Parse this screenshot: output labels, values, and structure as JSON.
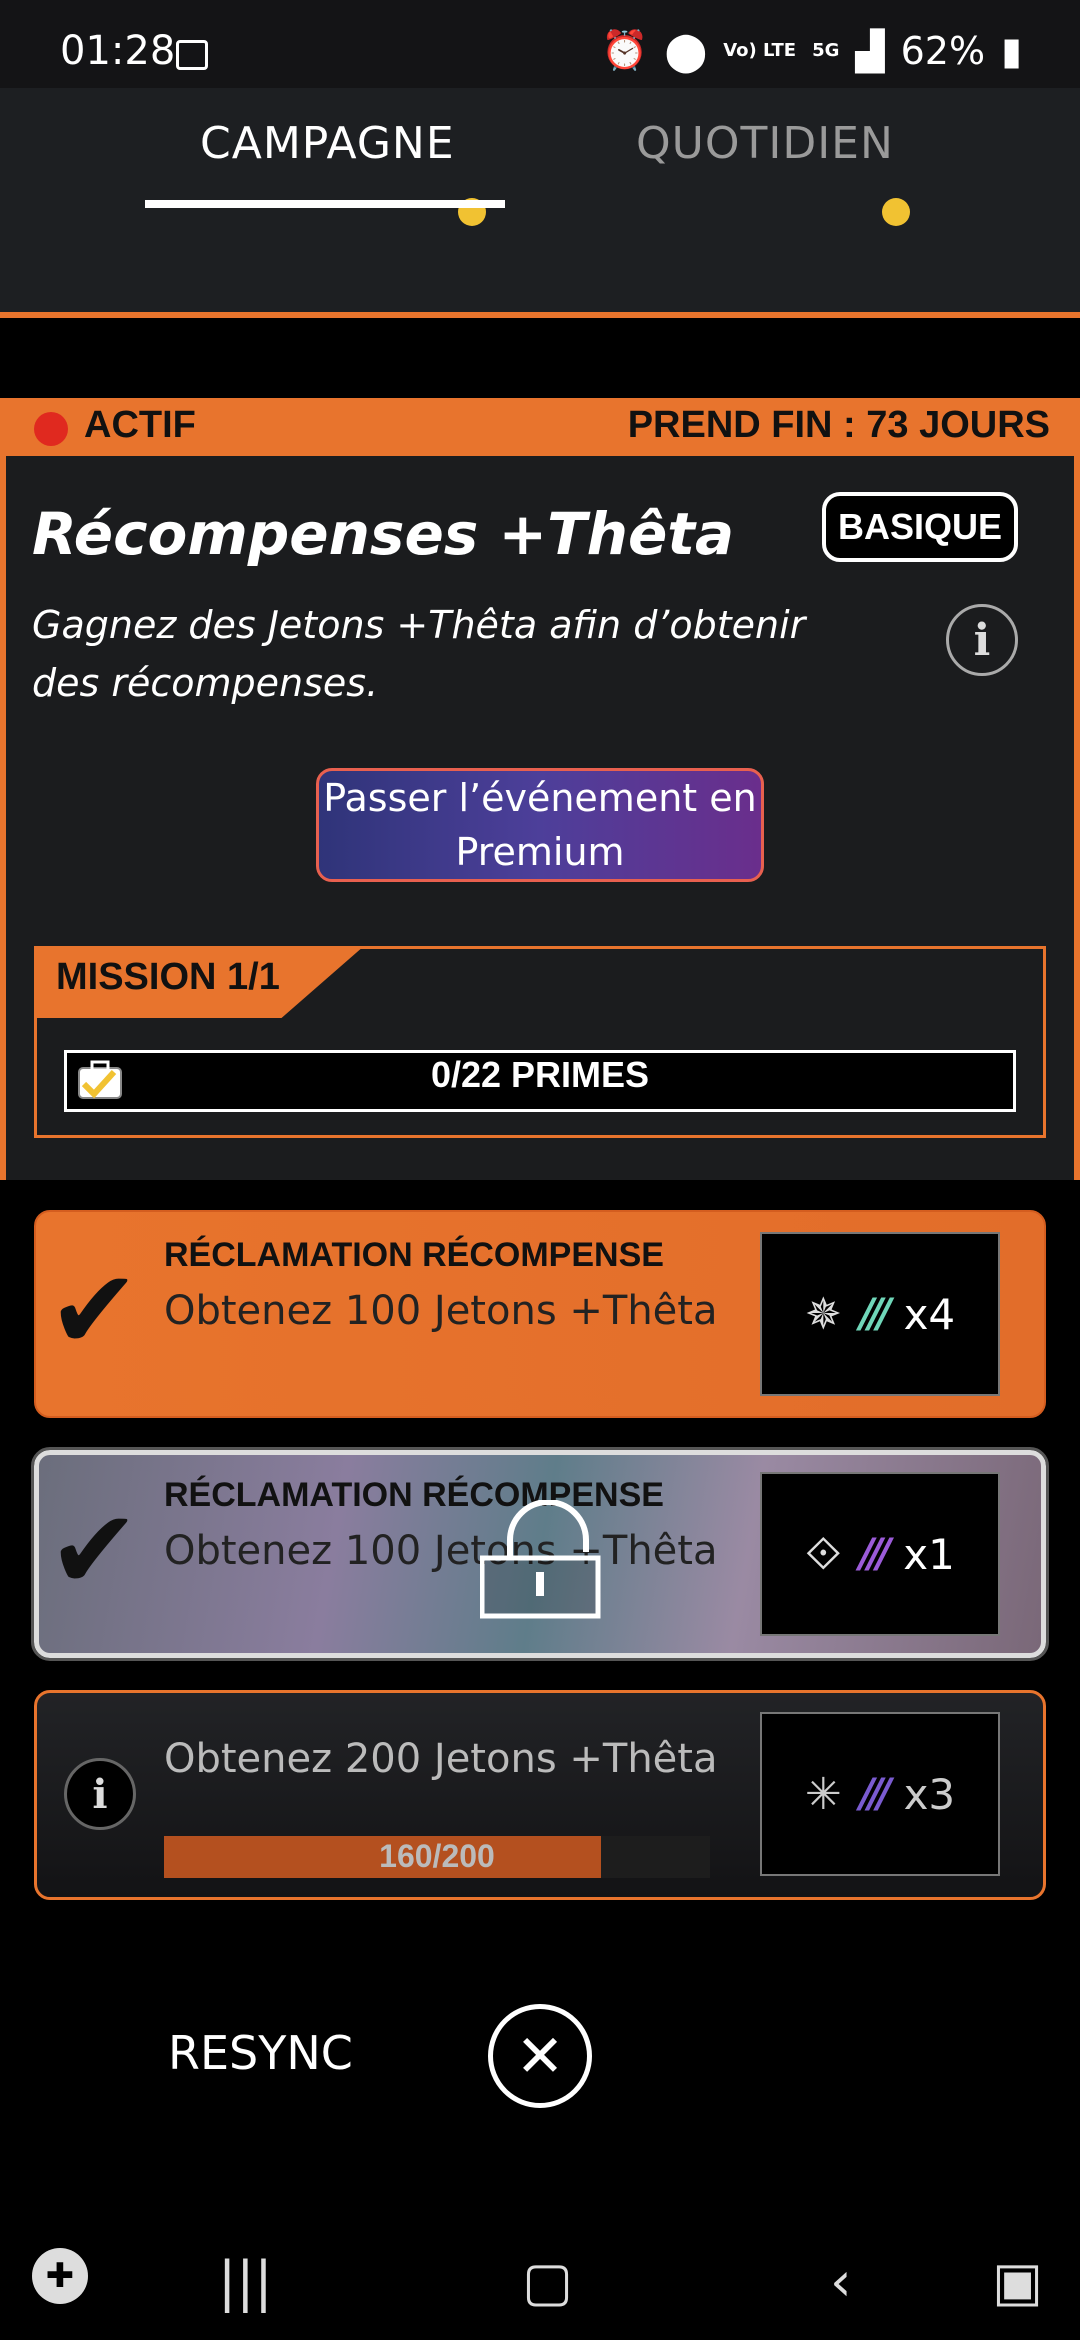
{
  "status_bar": {
    "time": "01:28",
    "volte": "Vo) LTE",
    "network": "5G",
    "battery": "62%"
  },
  "tabs": [
    {
      "label": "CAMPAGNE",
      "active": true,
      "has_dot": true
    },
    {
      "label": "QUOTIDIEN",
      "active": false,
      "has_dot": true
    }
  ],
  "event": {
    "status": "ACTIF",
    "ends": "PREND FIN : 73 JOURS",
    "title": "Récompenses +Thêta",
    "tier_badge": "BASIQUE",
    "description": "Gagnez des Jetons +Thêta afin d’obtenir des récompenses.",
    "premium_button": "Passer l’événement en Premium"
  },
  "mission": {
    "label": "MISSION 1/1",
    "bounties": "0/22 PRIMES"
  },
  "rewards": [
    {
      "label": "RÉCLAMATION RÉCOMPENSE",
      "task": "Obtenez 100 Jetons +Thêta",
      "quantity": "x4",
      "stripe_color": "#6fd6b9",
      "claimed": true,
      "locked": false
    },
    {
      "label": "RÉCLAMATION RÉCOMPENSE",
      "task": "Obtenez 100 Jetons +Thêta",
      "quantity": "x1",
      "stripe_color": "#9b5bd8",
      "claimed": true,
      "locked": true
    },
    {
      "task": "Obtenez 200 Jetons +Thêta",
      "progress_text": "160/200",
      "progress": 0.8,
      "quantity": "x3",
      "stripe_color": "#7a5bd0"
    }
  ],
  "controls": {
    "resync": "RESYNC"
  },
  "colors": {
    "accent": "#e8742d",
    "tab_dot": "#f1c232",
    "status_red": "#e0291f"
  }
}
